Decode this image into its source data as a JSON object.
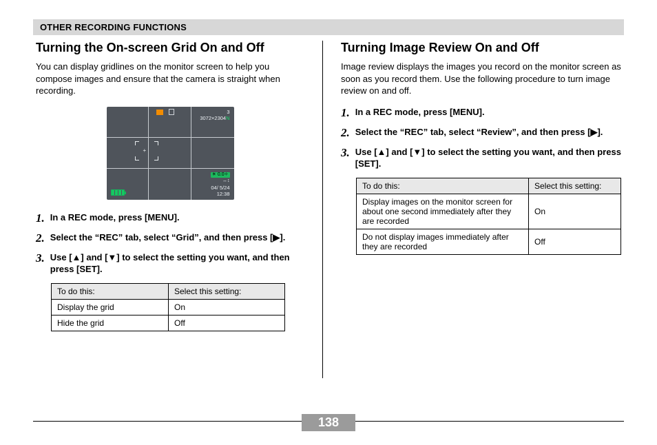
{
  "header": "OTHER RECORDING FUNCTIONS",
  "page_number": "138",
  "left": {
    "title": "Turning the On-screen Grid On and Off",
    "intro": "You can display gridlines on the monitor screen to help you compose images and ensure that the camera is straight when recording.",
    "screen": {
      "shots_remaining": "3",
      "resolution": "3072×2304",
      "resolution_suffix": "N",
      "ev": "0.0",
      "ev_prefix": "☀",
      "date": "04/ 5/24",
      "time": "12:38",
      "arrows": "↔↕"
    },
    "steps": [
      "In a REC mode, press [MENU].",
      "Select the “REC” tab, select “Grid”, and then press [▶].",
      "Use [▲] and [▼] to select the setting you want, and then press [SET]."
    ],
    "table": {
      "head": [
        "To do this:",
        "Select this setting:"
      ],
      "rows": [
        [
          "Display the grid",
          "On"
        ],
        [
          "Hide the grid",
          "Off"
        ]
      ]
    }
  },
  "right": {
    "title": "Turning Image Review On and Off",
    "intro": "Image review displays the images you record on the monitor screen as soon as you record them. Use the following procedure to turn image review on and off.",
    "steps": [
      "In a REC mode, press [MENU].",
      "Select the “REC” tab, select “Review”, and then press [▶].",
      "Use [▲] and [▼] to select the setting you want, and then press [SET]."
    ],
    "table": {
      "head": [
        "To do this:",
        "Select this setting:"
      ],
      "rows": [
        [
          "Display images on the monitor screen for about one second immediately after they are recorded",
          "On"
        ],
        [
          "Do not display images immediately after they are recorded",
          "Off"
        ]
      ]
    }
  }
}
